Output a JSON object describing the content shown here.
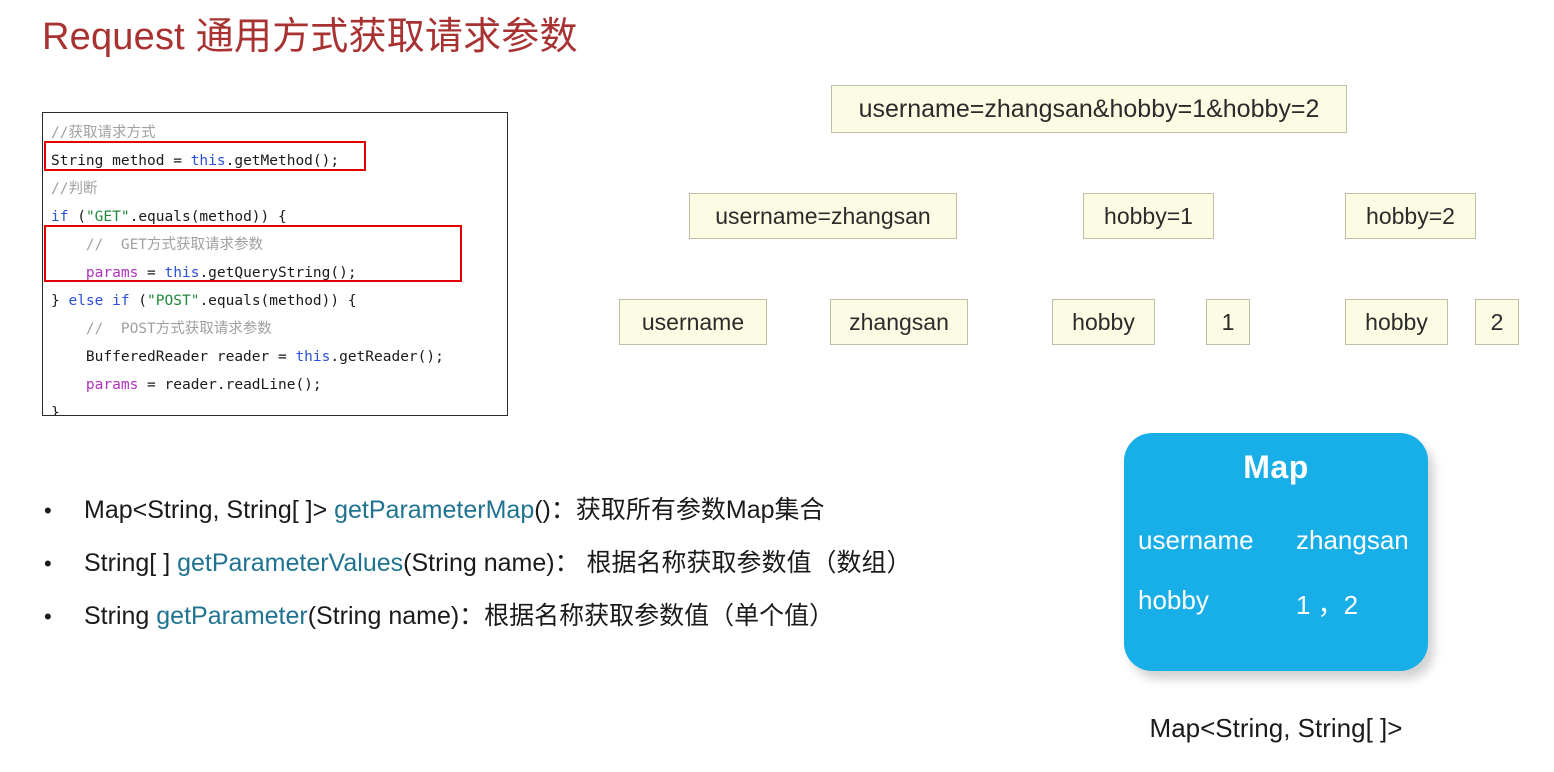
{
  "title": "Request 通用方式获取请求参数",
  "code": {
    "lines": [
      {
        "indent": 0,
        "tokens": [
          {
            "t": "cmt",
            "s": "//获取请求方式"
          }
        ]
      },
      {
        "indent": 0,
        "tokens": [
          {
            "t": "plain",
            "s": "String method = "
          },
          {
            "t": "this",
            "s": "this"
          },
          {
            "t": "plain",
            "s": ".getMethod();"
          }
        ]
      },
      {
        "indent": 0,
        "tokens": [
          {
            "t": "cmt",
            "s": "//判断"
          }
        ]
      },
      {
        "indent": 0,
        "tokens": [
          {
            "t": "kw",
            "s": "if"
          },
          {
            "t": "plain",
            "s": " ("
          },
          {
            "t": "str",
            "s": "\"GET\""
          },
          {
            "t": "plain",
            "s": ".equals(method)) {"
          }
        ]
      },
      {
        "indent": 1,
        "tokens": [
          {
            "t": "cmt",
            "s": "//  GET方式获取请求参数"
          }
        ]
      },
      {
        "indent": 1,
        "tokens": [
          {
            "t": "var",
            "s": "params"
          },
          {
            "t": "plain",
            "s": " = "
          },
          {
            "t": "this",
            "s": "this"
          },
          {
            "t": "plain",
            "s": ".getQueryString();"
          }
        ]
      },
      {
        "indent": 0,
        "tokens": [
          {
            "t": "plain",
            "s": "} "
          },
          {
            "t": "kw",
            "s": "else if"
          },
          {
            "t": "plain",
            "s": " ("
          },
          {
            "t": "str",
            "s": "\"POST\""
          },
          {
            "t": "plain",
            "s": ".equals(method)) {"
          }
        ]
      },
      {
        "indent": 1,
        "tokens": [
          {
            "t": "cmt",
            "s": "//  POST方式获取请求参数"
          }
        ]
      },
      {
        "indent": 1,
        "tokens": [
          {
            "t": "plain",
            "s": "BufferedReader reader = "
          },
          {
            "t": "this",
            "s": "this"
          },
          {
            "t": "plain",
            "s": ".getReader();"
          }
        ]
      },
      {
        "indent": 1,
        "tokens": [
          {
            "t": "var",
            "s": "params"
          },
          {
            "t": "plain",
            "s": " = reader.readLine();"
          }
        ]
      },
      {
        "indent": 0,
        "tokens": [
          {
            "t": "plain",
            "s": "}"
          }
        ]
      }
    ],
    "highlight_color": "#e00000"
  },
  "query_string": {
    "full": "username=zhangsan&hobby=1&hobby=2",
    "pairs": [
      "username=zhangsan",
      "hobby=1",
      "hobby=2"
    ],
    "parts": {
      "username_key": "username",
      "username_value": "zhangsan",
      "hobby1_key": "hobby",
      "hobby1_value": "1",
      "hobby2_key": "hobby",
      "hobby2_value": "2"
    }
  },
  "bullets": [
    {
      "marker": "•",
      "pre": "Map<String, String[ ]> ",
      "method": "getParameterMap",
      "post": "()：获取所有参数Map集合"
    },
    {
      "marker": "•",
      "pre": "String[ ] ",
      "method": "getParameterValues",
      "post": "(String name)： 根据名称获取参数值（数组）"
    },
    {
      "marker": "•",
      "pre": "String ",
      "method": "getParameter",
      "post": "(String name)：根据名称获取参数值（单个值）"
    }
  ],
  "map_box": {
    "title": "Map",
    "rows": [
      {
        "key": "username",
        "value": "zhangsan"
      },
      {
        "key": "hobby",
        "value": "1 ，2"
      }
    ],
    "caption": "Map<String, String[ ]>",
    "fill_color": "#18AEE8"
  },
  "colors": {
    "title": "#A83232",
    "method_link": "#1F7391",
    "box_fill": "#FCFBE3",
    "box_border": "#BFBFA8",
    "highlight": "#e00000",
    "map_fill": "#18AEE8"
  }
}
